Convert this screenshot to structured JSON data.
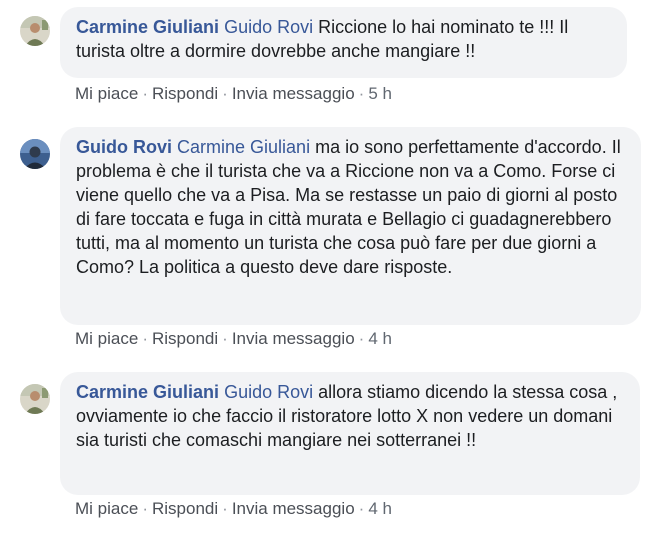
{
  "comments": [
    {
      "author": "Carmine Giuliani",
      "mention": "Guido Rovi",
      "text": "Riccione lo hai nominato te !!! Il turista oltre a dormire dovrebbe anche mangiare !!",
      "like": "Mi piace",
      "reply": "Rispondi",
      "message": "Invia messaggio",
      "time": "5 h",
      "avatar_icon": "profile-photo-icon"
    },
    {
      "author": "Guido Rovi",
      "mention": "Carmine Giuliani",
      "text": "ma io sono perfettamente d'accordo. Il problema è che il turista che va a Riccione non va a Como. Forse ci viene quello che va a Pisa. Ma se restasse un paio di giorni al posto di fare toccata e fuga in città murata e Bellagio ci guadagnerebbero tutti, ma al momento un turista che cosa può fare per due giorni a Como? La politica a questo deve dare risposte.",
      "like": "Mi piace",
      "reply": "Rispondi",
      "message": "Invia messaggio",
      "time": "4 h",
      "avatar_icon": "profile-photo-icon"
    },
    {
      "author": "Carmine Giuliani",
      "mention": "Guido Rovi",
      "text": "allora stiamo dicendo la stessa cosa , ovviamente io che faccio il ristoratore lotto X non vedere un domani sia turisti che comaschi mangiare nei sotterranei !!",
      "like": "Mi piace",
      "reply": "Rispondi",
      "message": "Invia messaggio",
      "time": "4 h",
      "avatar_icon": "profile-photo-icon"
    }
  ],
  "separator": "·",
  "colors": {
    "bubble_bg": "#f2f3f5",
    "name_link": "#385898",
    "text": "#1c1e21",
    "meta": "#606770"
  }
}
